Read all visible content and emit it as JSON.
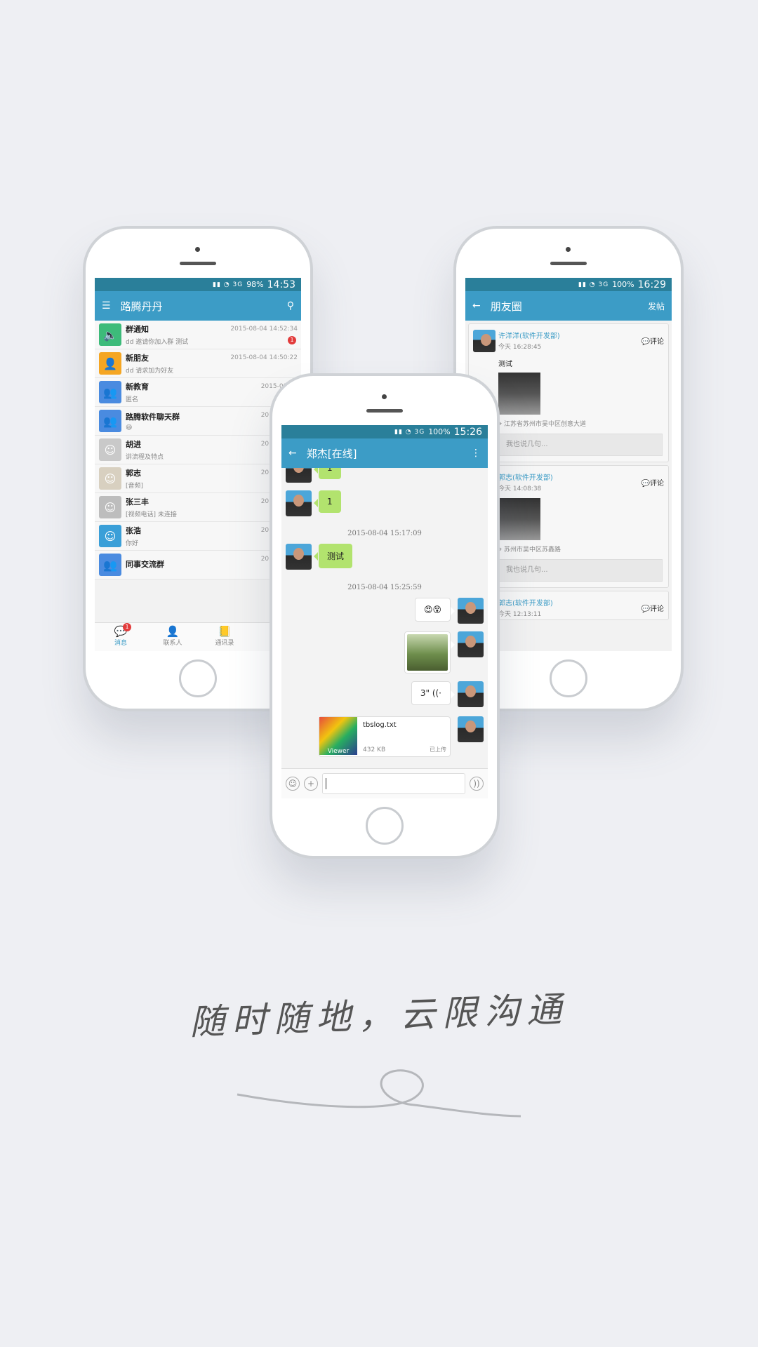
{
  "slogan": "随时随地，云限沟通",
  "phone_left": {
    "status": {
      "signal": "98%",
      "time": "14:53"
    },
    "appbar": {
      "title": "路腾丹丹",
      "menu_icon": "menu-icon",
      "search_icon": "search-icon"
    },
    "conversations": [
      {
        "name": "群通知",
        "preview": "dd 邀请你加入群 测试",
        "time": "2015-08-04 14:52:34",
        "badge": "1",
        "avatar_color": "#3dbb7a",
        "icon": "speaker-icon"
      },
      {
        "name": "新朋友",
        "preview": "dd 请求加为好友",
        "time": "2015-08-04 14:50:22",
        "avatar_color": "#f5a623",
        "icon": "person-icon"
      },
      {
        "name": "新教育",
        "preview": "匿名",
        "time": "2015-08-04",
        "avatar_color": "#4a8be0",
        "icon": "group-icon"
      },
      {
        "name": "路腾软件聊天群",
        "preview": "😄",
        "time": "2015-08-04",
        "avatar_color": "#4a8be0",
        "icon": "group-icon"
      },
      {
        "name": "胡进",
        "preview": "讲流程及特点",
        "time": "2015-08-04",
        "avatar_color": "#c9c9c9",
        "icon": "photo-avatar"
      },
      {
        "name": "郭志",
        "preview": "[音频]",
        "time": "2015-08-04",
        "avatar_color": "#d8d0c0",
        "icon": "photo-avatar"
      },
      {
        "name": "张三丰",
        "preview": "[视频电话] 未连接",
        "time": "2015-08-04",
        "avatar_color": "#bdbdbd",
        "icon": "photo-avatar"
      },
      {
        "name": "张浩",
        "preview": "你好",
        "time": "2015-08-03",
        "avatar_color": "#3a9fd8",
        "icon": "photo-avatar"
      },
      {
        "name": "同事交流群",
        "preview": "",
        "time": "2015-08-01",
        "avatar_color": "#4a8be0",
        "icon": "group-icon"
      }
    ],
    "tabs": [
      {
        "label": "消息",
        "icon": "chat-icon",
        "badge": "1"
      },
      {
        "label": "联系人",
        "icon": "contacts-icon"
      },
      {
        "label": "通讯录",
        "icon": "addressbook-icon"
      }
    ]
  },
  "phone_center": {
    "status": {
      "signal": "100%",
      "time": "15:26"
    },
    "appbar": {
      "title": "郑杰[在线]",
      "back_icon": "back-arrow-icon",
      "more_icon": "more-icon"
    },
    "messages": [
      {
        "side": "left",
        "type": "text",
        "text": "1"
      },
      {
        "side": "left",
        "type": "text",
        "text": "1"
      },
      {
        "type": "time",
        "text": "2015-08-04 15:17:09"
      },
      {
        "side": "left",
        "type": "text",
        "text": "测试"
      },
      {
        "type": "time",
        "text": "2015-08-04 15:25:59"
      },
      {
        "side": "right",
        "type": "text",
        "text": "😍😵"
      },
      {
        "side": "right",
        "type": "image"
      },
      {
        "side": "right",
        "type": "voice",
        "text": "3\""
      },
      {
        "side": "right",
        "type": "file",
        "file_name": "tbslog.txt",
        "file_size": "432 KB",
        "file_status": "已上传",
        "app_label": "Viewer"
      }
    ]
  },
  "phone_right": {
    "status": {
      "signal": "100%",
      "time": "16:29"
    },
    "appbar": {
      "title": "朋友圈",
      "action": "发帖",
      "back_icon": "back-arrow-icon"
    },
    "posts": [
      {
        "name": "许洋洋(软件开发部)",
        "time": "今天 16:28:45",
        "text": "测试",
        "location": "江苏省苏州市吴中区创意大道",
        "comment_label": "评论",
        "say_placeholder": "我也说几句..."
      },
      {
        "name": "郭志(软件开发部)",
        "time": "今天 14:08:38",
        "text": "",
        "location": "苏州市吴中区苏鑫路",
        "comment_label": "评论",
        "say_placeholder": "我也说几句..."
      },
      {
        "name": "郭志(软件开发部)",
        "time": "今天 12:13:11",
        "text": "",
        "location": "",
        "comment_label": "评论",
        "say_placeholder": ""
      }
    ]
  }
}
